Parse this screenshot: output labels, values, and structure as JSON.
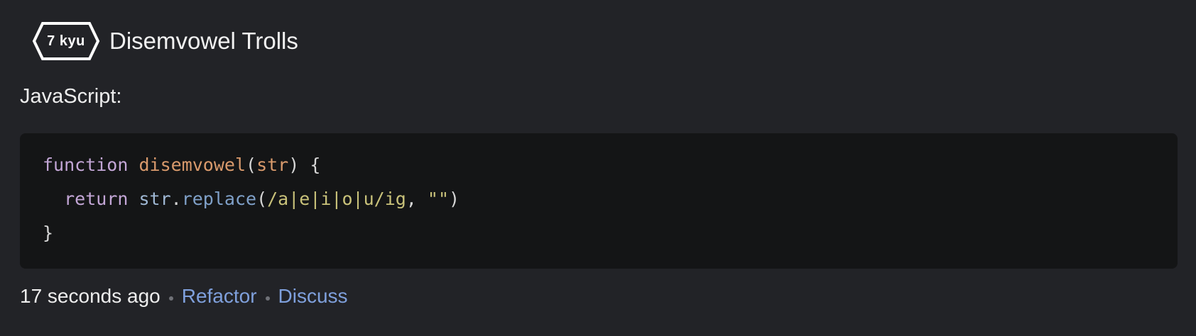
{
  "kata": {
    "rank": "7 kyu",
    "title": "Disemvowel Trolls"
  },
  "solution": {
    "language_label": "JavaScript:",
    "code": {
      "line1": {
        "kw": "function",
        "fn": "disemvowel",
        "open_paren": "(",
        "param": "str",
        "close": ") {"
      },
      "line2": {
        "indent": "  ",
        "kw": "return",
        "obj": "str",
        "dot": ".",
        "method": "replace",
        "open_paren": "(",
        "regex": "/a|e|i|o|u/ig",
        "comma": ", ",
        "str": "\"\"",
        "close_paren": ")"
      },
      "line3": {
        "close": "}"
      }
    }
  },
  "meta": {
    "timestamp": "17 seconds ago",
    "refactor_label": "Refactor",
    "discuss_label": "Discuss"
  },
  "colors": {
    "background": "#222327",
    "code_background": "#141516",
    "link": "#7fa0dc"
  }
}
